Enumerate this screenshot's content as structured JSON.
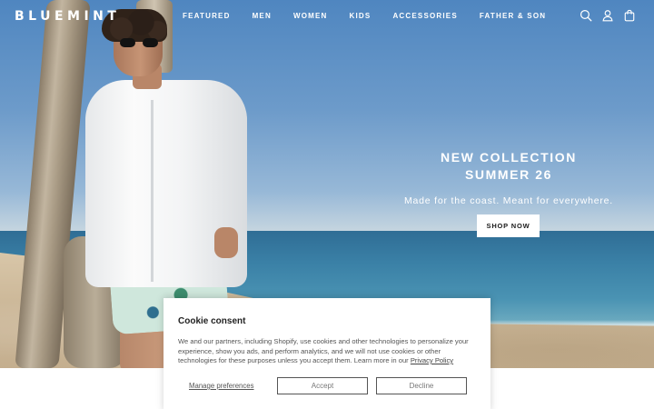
{
  "brand": {
    "logo": "BLUEMINT"
  },
  "nav": {
    "items": [
      "FEATURED",
      "MEN",
      "WOMEN",
      "KIDS",
      "ACCESSORIES",
      "FATHER & SON"
    ]
  },
  "header_icons": [
    "search-icon",
    "account-icon",
    "cart-icon"
  ],
  "hero": {
    "title_line1": "NEW COLLECTION",
    "title_line2": "SUMMER 26",
    "subtitle": "Made for the coast. Meant for everywhere.",
    "cta_label": "SHOP NOW"
  },
  "cookie": {
    "title": "Cookie consent",
    "body": "We and our partners, including Shopify, use cookies and other technologies to personalize your experience, show you ads, and perform analytics, and we will not use cookies or other technologies for these purposes unless you accept them. Learn more in our ",
    "link_text": "Privacy Policy",
    "manage_label": "Manage preferences",
    "accept_label": "Accept",
    "decline_label": "Decline"
  }
}
